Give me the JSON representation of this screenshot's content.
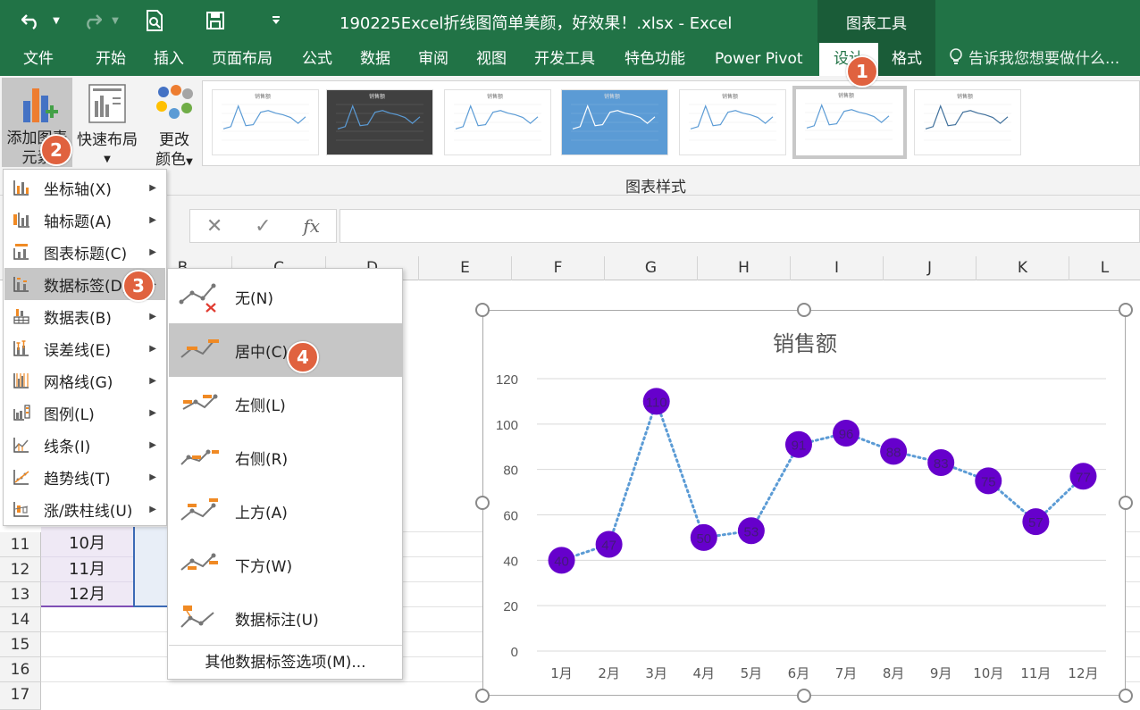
{
  "window": {
    "title": "190225Excel折线图简单美颜，好效果！.xlsx - Excel",
    "context_tab": "图表工具"
  },
  "tabs": [
    "文件",
    "开始",
    "插入",
    "页面布局",
    "公式",
    "数据",
    "审阅",
    "视图",
    "开发工具",
    "特色功能",
    "Power Pivot",
    "设计",
    "格式"
  ],
  "tell_me": "告诉我您想要做什么...",
  "ribbon": {
    "add_element": "添加图表元素",
    "add_element_line1": "添加图表",
    "add_element_line2": "元素",
    "quick_layout": "快速布局",
    "change_colors_line1": "更改",
    "change_colors_line2": "颜色",
    "styles_group": "图表样式",
    "thumb_title": "销售额"
  },
  "formula_bar": {
    "cancel": "✕",
    "confirm": "✓",
    "fx": "fx"
  },
  "columns": [
    "B",
    "C",
    "D",
    "E",
    "F",
    "G",
    "H",
    "I",
    "J",
    "K",
    "L"
  ],
  "rows": [
    {
      "num": "11",
      "value": "10月"
    },
    {
      "num": "12",
      "value": "11月"
    },
    {
      "num": "13",
      "value": "12月"
    },
    {
      "num": "14",
      "value": ""
    },
    {
      "num": "15",
      "value": ""
    },
    {
      "num": "16",
      "value": ""
    },
    {
      "num": "17",
      "value": ""
    }
  ],
  "menu": {
    "items": [
      {
        "label": "坐标轴(X)",
        "icon": "axis-icon"
      },
      {
        "label": "轴标题(A)",
        "icon": "axis-title-icon"
      },
      {
        "label": "图表标题(C)",
        "icon": "chart-title-icon"
      },
      {
        "label": "数据标签(D)",
        "icon": "data-labels-icon"
      },
      {
        "label": "数据表(B)",
        "icon": "data-table-icon"
      },
      {
        "label": "误差线(E)",
        "icon": "error-bars-icon"
      },
      {
        "label": "网格线(G)",
        "icon": "gridlines-icon"
      },
      {
        "label": "图例(L)",
        "icon": "legend-icon"
      },
      {
        "label": "线条(I)",
        "icon": "lines-icon"
      },
      {
        "label": "趋势线(T)",
        "icon": "trendline-icon"
      },
      {
        "label": "涨/跌柱线(U)",
        "icon": "up-down-bars-icon"
      }
    ]
  },
  "submenu": {
    "items": [
      {
        "label": "无(N)",
        "icon": "label-none-icon"
      },
      {
        "label": "居中(C)",
        "icon": "label-center-icon"
      },
      {
        "label": "左侧(L)",
        "icon": "label-left-icon"
      },
      {
        "label": "右侧(R)",
        "icon": "label-right-icon"
      },
      {
        "label": "上方(A)",
        "icon": "label-above-icon"
      },
      {
        "label": "下方(W)",
        "icon": "label-below-icon"
      },
      {
        "label": "数据标注(U)",
        "icon": "data-callout-icon"
      }
    ],
    "more": "其他数据标签选项(M)..."
  },
  "callouts": [
    "1",
    "2",
    "3",
    "4"
  ],
  "colors": {
    "excel_green": "#217346",
    "marker": "#6600cc",
    "line": "#5b9bd5",
    "callout": "#e0623f"
  },
  "chart_data": {
    "type": "line",
    "title": "销售额",
    "categories": [
      "1月",
      "2月",
      "3月",
      "4月",
      "5月",
      "6月",
      "7月",
      "8月",
      "9月",
      "10月",
      "11月",
      "12月"
    ],
    "values": [
      40,
      47,
      110,
      50,
      53,
      91,
      96,
      88,
      83,
      75,
      57,
      77
    ],
    "ylim": [
      0,
      120
    ],
    "yticks": [
      "0",
      "20",
      "40",
      "60",
      "80",
      "100",
      "120"
    ],
    "grid": true,
    "line_style": "dotted",
    "data_labels": "center"
  }
}
